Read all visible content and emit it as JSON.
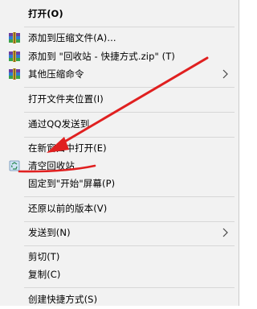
{
  "menu": {
    "items": [
      {
        "label": "打开(O)"
      },
      {
        "label": "添加到压缩文件(A)..."
      },
      {
        "label": "添加到 \"回收站 - 快捷方式.zip\" (T)"
      },
      {
        "label": "其他压缩命令"
      },
      {
        "label": "打开文件夹位置(I)"
      },
      {
        "label": "通过QQ发送到"
      },
      {
        "label": "在新窗口中打开(E)"
      },
      {
        "label": "清空回收站"
      },
      {
        "label": "固定到\"开始\"屏幕(P)"
      },
      {
        "label": "还原以前的版本(V)"
      },
      {
        "label": "发送到(N)"
      },
      {
        "label": "剪切(T)"
      },
      {
        "label": "复制(C)"
      },
      {
        "label": "创建快捷方式(S)"
      }
    ]
  },
  "annotation": {
    "color": "#e02020"
  },
  "icons": {
    "archive": "winrar-archive-icon",
    "recycle": "recycle-bin-icon",
    "submenu": "chevron-right-icon"
  }
}
